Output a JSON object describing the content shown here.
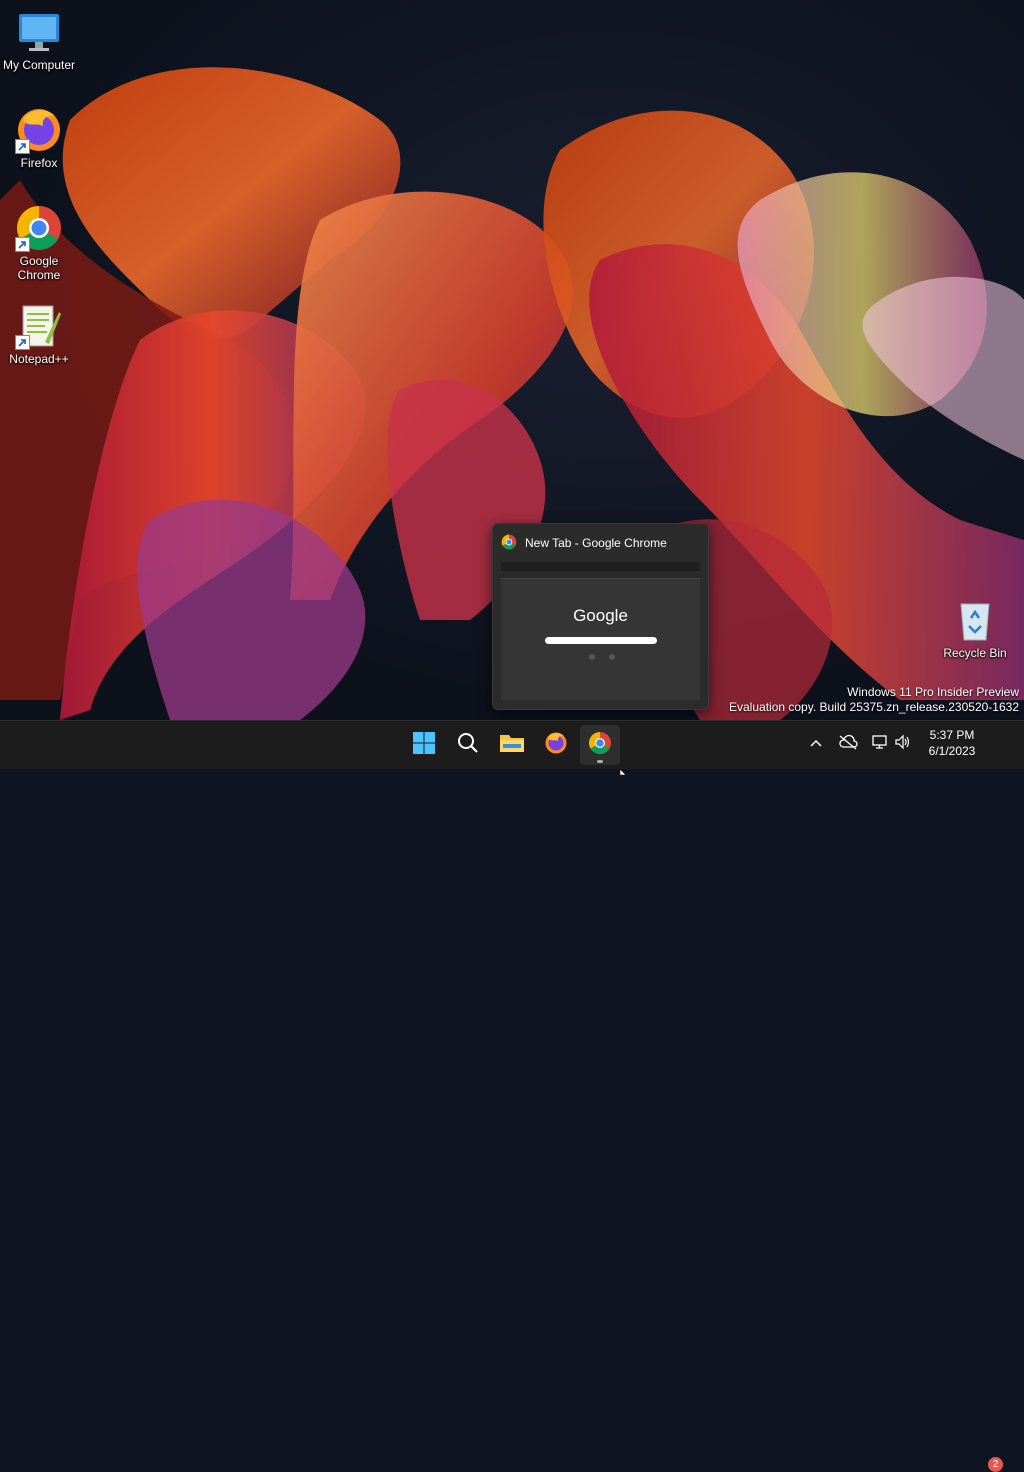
{
  "desktop": {
    "icons": [
      {
        "label": "My Computer",
        "icon": "monitor-icon"
      },
      {
        "label": "Firefox",
        "icon": "firefox-icon"
      },
      {
        "label": "Google\nChrome",
        "icon": "chrome-icon"
      },
      {
        "label": "Notepad++",
        "icon": "notepadpp-icon"
      },
      {
        "label": "Recycle Bin",
        "icon": "recycle-bin-icon"
      }
    ]
  },
  "watermark": {
    "line1": "Windows 11 Pro Insider Preview",
    "line2": "Evaluation copy. Build 25375.zn_release.230520-1632"
  },
  "preview": {
    "title": "New Tab - Google Chrome",
    "thumb_logo": "Google"
  },
  "taskbar": {
    "buttons": [
      "start-icon",
      "search-icon",
      "file-explorer-icon",
      "firefox-icon",
      "chrome-icon"
    ],
    "active": "chrome-icon"
  },
  "tray": {
    "icons": [
      "chevron-up-icon",
      "onedrive-offline-icon",
      "network-icon",
      "volume-icon"
    ],
    "time": "5:37 PM",
    "date": "6/1/2023",
    "notifications": "2"
  }
}
